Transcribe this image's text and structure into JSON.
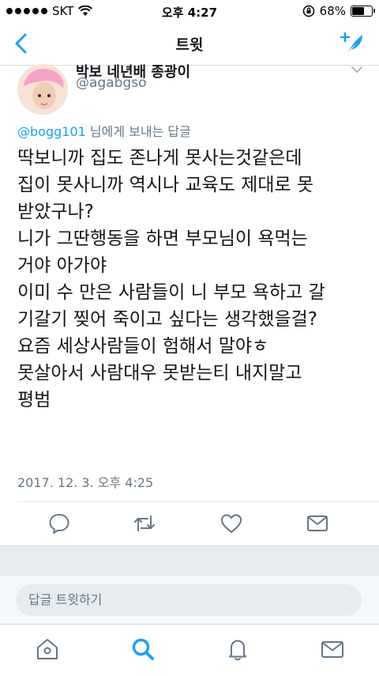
{
  "status": {
    "carrier": "SKT",
    "time": "오후 4:27",
    "battery": "68%",
    "battery_level": 0.68
  },
  "nav": {
    "title": "트윗"
  },
  "author": {
    "name": "박보 네년배 종광이",
    "handle": "@agabgso"
  },
  "reply_to": {
    "mention": "@bogg101",
    "suffix": " 님에게 보내는 답글"
  },
  "tweet": {
    "lines": [
      "딱보니까 집도 존나게 못사는것같은데",
      "집이 못사니까 역시나 교육도 제대로 못",
      "받았구나?",
      "니가 그딴행동을 하면 부모님이 욕먹는",
      "거야 아가야",
      "이미 수 만은 사람들이 니 부모 욕하고 갈",
      "기갈기 찢어 죽이고 싶다는 생각했을걸?",
      "요즘 세상사람들이 험해서 말야ㅎ",
      "못살아서 사람대우 못받는티 내지말고",
      "평범"
    ],
    "timestamp": "2017. 12. 3. 오후 4:25"
  },
  "reply_bar": {
    "placeholder": "답글 트윗하기"
  },
  "colors": {
    "accent": "#1da1f2",
    "secondary_text": "#657786",
    "icon_gray": "#657786"
  }
}
